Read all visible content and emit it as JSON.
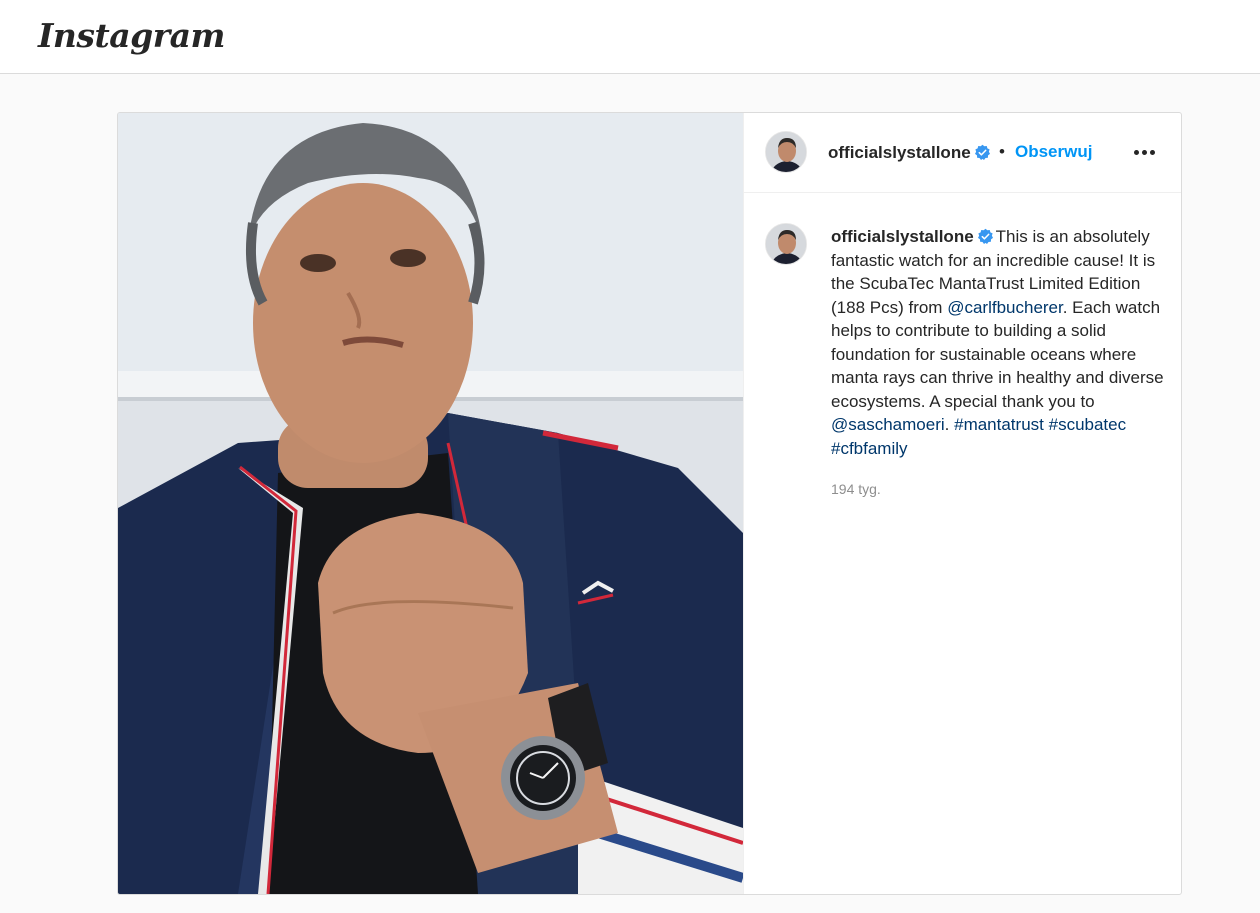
{
  "app": {
    "logo_text": "Instagram"
  },
  "post": {
    "username": "officialslystallone",
    "verified": true,
    "separator": "•",
    "follow_label": "Obserwuj",
    "more_icon": "more-options-icon",
    "caption": {
      "username": "officialslystallone",
      "text_1": "This is an absolutely fantastic watch for an incredible cause! It is the ScubaTec MantaTrust Limited Edition (188 Pcs) from ",
      "mention_1": "@carlfbucherer",
      "text_2": ". Each watch helps to contribute to building a solid foundation for sustainable oceans where manta rays can thrive in healthy and diverse ecosystems. A special thank you to ",
      "mention_2": "@saschamoeri",
      "text_3": ".",
      "hashtag_1": "#mantatrust",
      "hashtag_2": "#scubatec",
      "hashtag_3": "#cfbfamily"
    },
    "time_ago": "194 tyg."
  },
  "colors": {
    "link_blue": "#0095f6",
    "mention_blue": "#00376b",
    "verified_blue": "#3897f0",
    "muted_gray": "#8e8e8e",
    "border": "#dbdbdb"
  }
}
